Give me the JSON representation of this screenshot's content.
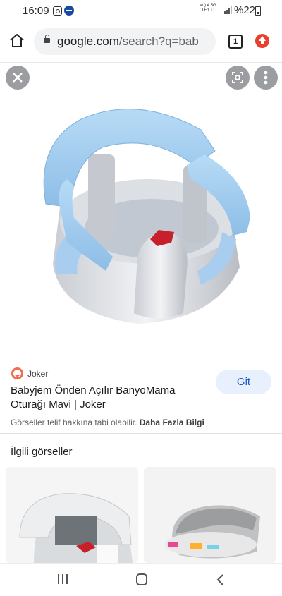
{
  "status_bar": {
    "time": "16:09",
    "network_top": "Vo) 4.5G",
    "network_bottom": "LTE1 ↓↑",
    "battery": "%22"
  },
  "browser": {
    "url_host": "google.com",
    "url_path": "/search?q=bab",
    "tab_count": "1"
  },
  "result": {
    "source_name": "Joker",
    "title": "Babyjem Önden Açılır BanyoMama Oturağı Mavi | Joker",
    "visit_label": "Git",
    "copyright_text": "Görseller telif hakkına tabi olabilir.",
    "more_info_label": "Daha Fazla Bilgi"
  },
  "related": {
    "heading": "İlgili görseller"
  },
  "icons": [
    "home-icon",
    "lock-icon",
    "tabs-icon",
    "update-icon",
    "close-icon",
    "lens-icon",
    "more-vert-icon",
    "recents-icon",
    "home-nav-icon",
    "back-icon"
  ],
  "colors": {
    "accent": "#1a56c5",
    "button_bg": "#e8f0fe",
    "seat_blue": "#9cc8ec",
    "update_red": "#e8402c"
  }
}
